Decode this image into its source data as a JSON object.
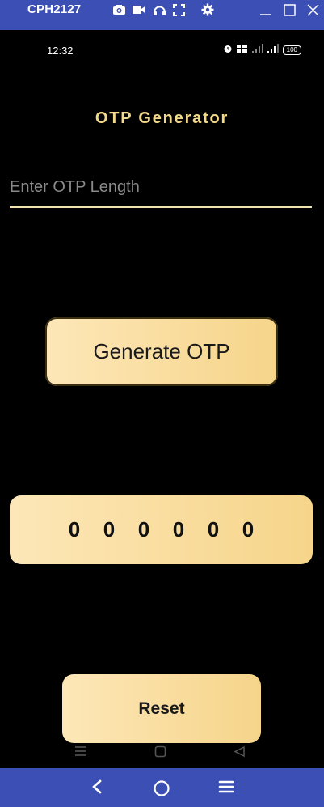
{
  "window": {
    "device_name": "CPH2127",
    "icons": [
      "camera-icon",
      "video-icon",
      "headset-icon",
      "fullscreen-icon",
      "settings-icon",
      "minimize-icon",
      "maximize-icon",
      "close-icon"
    ]
  },
  "statusbar": {
    "time": "12:32",
    "battery": "100",
    "icons": [
      "alarm-icon",
      "volte-icon",
      "signal-icon",
      "signal-icon",
      "battery-icon"
    ]
  },
  "app": {
    "title": "OTP Generator",
    "input_placeholder": "Enter OTP Length",
    "input_value": "",
    "generate_label": "Generate OTP",
    "otp_digits": [
      "0",
      "0",
      "0",
      "0",
      "0",
      "0"
    ],
    "reset_label": "Reset"
  },
  "colors": {
    "title_gold": "#f3d98a",
    "button_gradient_start": "#fde7b8",
    "button_gradient_end": "#f6d58a",
    "frame_blue": "#3b4fb5",
    "background": "#000000"
  }
}
